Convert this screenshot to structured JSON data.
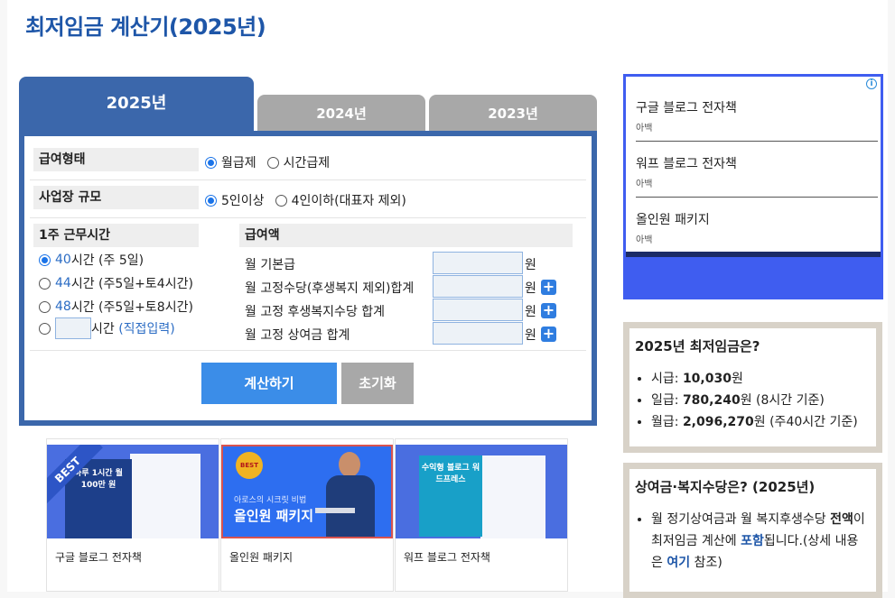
{
  "page": {
    "title": "최저임금 계산기(2025년)"
  },
  "tabs": [
    {
      "label": "2025년",
      "active": true
    },
    {
      "label": "2024년",
      "active": false
    },
    {
      "label": "2023년",
      "active": false
    }
  ],
  "form": {
    "pay_type": {
      "label": "급여형태",
      "options": [
        "월급제",
        "시간급제"
      ],
      "selected": "월급제"
    },
    "workplace_size": {
      "label": "사업장 규모",
      "options": [
        "5인이상",
        "4인이하(대표자 제외)"
      ],
      "selected": "5인이상"
    },
    "weekly_hours": {
      "label": "1주 근무시간",
      "unit": "시간",
      "options": [
        {
          "value": "40",
          "desc": "(주 5일)",
          "selected": true
        },
        {
          "value": "44",
          "desc": "(주5일+토4시간)",
          "selected": false
        },
        {
          "value": "48",
          "desc": "(주5일+토8시간)",
          "selected": false
        }
      ],
      "custom": {
        "value": "",
        "hint": "(직접입력)"
      }
    },
    "pay_amount": {
      "label": "급여액",
      "unit": "원",
      "items": [
        {
          "label": "월 기본급",
          "value": "",
          "has_plus": false
        },
        {
          "label": "월 고정수당(후생복지 제외)합계",
          "value": "",
          "has_plus": true
        },
        {
          "label": "월 고정 후생복지수당 합계",
          "value": "",
          "has_plus": true
        },
        {
          "label": "월 고정 상여금 합계",
          "value": "",
          "has_plus": true
        }
      ]
    },
    "buttons": {
      "calculate": "계산하기",
      "reset": "초기화"
    }
  },
  "products": [
    {
      "title": "구글 블로그 전자책",
      "badge": "BEST",
      "cover_text": "하루 1시간 월 100만 원"
    },
    {
      "title": "올인원 패키지",
      "badge": "BEST",
      "banner_sub": "아로스의 시크릿 비법",
      "banner_title": "올인원 패키지"
    },
    {
      "title": "워프 블로그 전자책",
      "cover_text": "수익형 블로그 워드프레스"
    }
  ],
  "ad": {
    "items": [
      {
        "title": "구글 블로그 전자책",
        "sub": "아백"
      },
      {
        "title": "워프 블로그 전자책",
        "sub": "아백"
      },
      {
        "title": "올인원 패키지",
        "sub": "아백"
      }
    ]
  },
  "min_wage_box": {
    "title": "2025년 최저임금은?",
    "items": [
      {
        "label": "시급: ",
        "value": "10,030",
        "suffix": "원"
      },
      {
        "label": "일급: ",
        "value": "780,240",
        "suffix": "원 (8시간 기준)"
      },
      {
        "label": "월급: ",
        "value": "2,096,270",
        "suffix": "원 (주40시간 기준)"
      }
    ]
  },
  "bonus_box": {
    "title": "상여금·복지수당은? (2025년)",
    "line1": "월 정기상여금과 월 복지후생수당",
    "strong1": "전액",
    "mid": "이 최저임금 계산에 ",
    "strong2": "포함",
    "line2": "됩니다.(상세 내용은 ",
    "link": "여기",
    "line3": " 참조)"
  }
}
